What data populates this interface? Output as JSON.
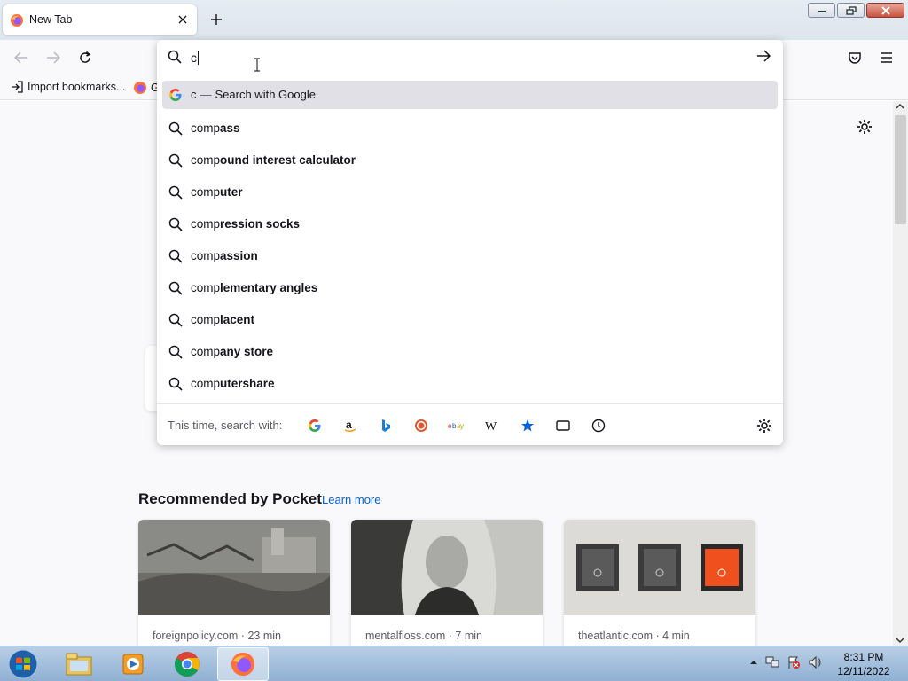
{
  "tab": {
    "title": "New Tab"
  },
  "bookmarks": {
    "import_label": "Import bookmarks...",
    "second_label": "G"
  },
  "urlbar": {
    "value": "c"
  },
  "suggestions": {
    "first": {
      "query": "c",
      "separator": "—",
      "action": "Search with Google"
    },
    "items": [
      {
        "prefix": "comp",
        "suffix": "ass"
      },
      {
        "prefix": "comp",
        "suffix": "ound interest calculator"
      },
      {
        "prefix": "comp",
        "suffix": "uter"
      },
      {
        "prefix": "comp",
        "suffix": "ression socks"
      },
      {
        "prefix": "comp",
        "suffix": "assion"
      },
      {
        "prefix": "comp",
        "suffix": "lementary angles"
      },
      {
        "prefix": "comp",
        "suffix": "lacent"
      },
      {
        "prefix": "comp",
        "suffix": "any store"
      },
      {
        "prefix": "comp",
        "suffix": "utershare"
      }
    ]
  },
  "engines": {
    "label": "This time, search with:",
    "icons": [
      "google-icon",
      "amazon-icon",
      "bing-icon",
      "duckduckgo-icon",
      "ebay-icon",
      "wikipedia-icon",
      "bookmarks-icon",
      "tabs-icon",
      "history-icon"
    ]
  },
  "pocket": {
    "heading": "Recommended by Pocket",
    "learn_more": "Learn more",
    "cards": [
      {
        "source": "foreignpolicy.com · 23 min"
      },
      {
        "source": "mentalfloss.com · 7 min"
      },
      {
        "source": "theatlantic.com · 4 min"
      }
    ]
  },
  "taskbar": {
    "time": "8:31 PM",
    "date": "12/11/2022"
  },
  "colors": {
    "accent": "#0061e0",
    "selected_row": "#e0e0e6",
    "taskbar": "#a9c3df"
  }
}
